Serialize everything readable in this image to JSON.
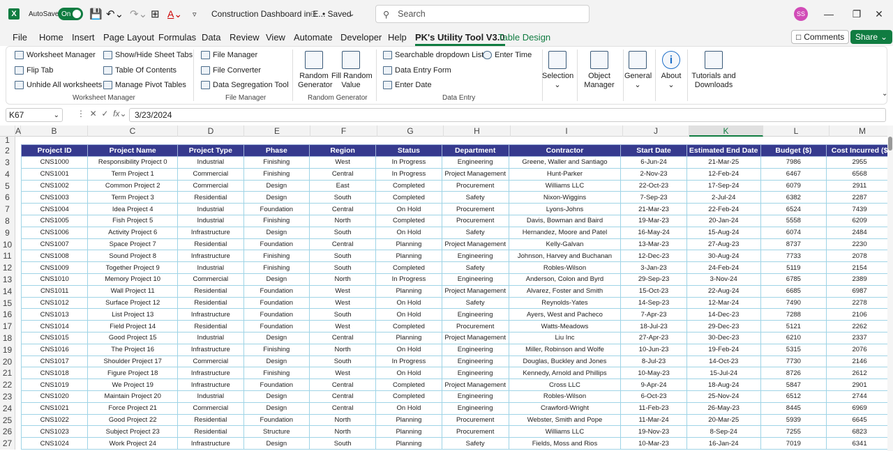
{
  "titlebar": {
    "app_icon": "X",
    "autosave_label": "AutoSave",
    "autosave_state": "On",
    "doc_title": "Construction Dashboard in E...",
    "saved_status": "• Saved",
    "search_placeholder": "Search",
    "user_initials": "SS"
  },
  "menu_tabs": [
    "File",
    "Home",
    "Insert",
    "Page Layout",
    "Formulas",
    "Data",
    "Review",
    "View",
    "Automate",
    "Developer",
    "Help",
    "PK's Utility Tool V3.0",
    "Table Design"
  ],
  "active_tab": "PK's Utility Tool V3.0",
  "comments_label": "Comments",
  "share_label": "Share",
  "ribbon": {
    "worksheet_manager": {
      "items": [
        "Worksheet Manager",
        "Flip Tab",
        "Unhide All worksheets",
        "Show/Hide Sheet Tabs",
        "Table Of Contents",
        "Manage Pivot Tables"
      ],
      "group_label": "Worksheet Manager"
    },
    "file_manager": {
      "items": [
        "File Manager",
        "File Converter",
        "Data Segregation Tool"
      ],
      "group_label": "File Manager"
    },
    "random_generator": {
      "items": [
        "Random\nGenerator",
        "Fill Random\nValue"
      ],
      "group_label": "Random Generator"
    },
    "data_entry": {
      "items": [
        "Searchable dropdown List",
        "Data Entry Form",
        "Enter Date",
        "Enter Time"
      ],
      "group_label": "Data Entry"
    },
    "big_buttons": [
      "Selection",
      "Object\nManager",
      "General",
      "About",
      "Tutorials and\nDownloads"
    ]
  },
  "formula_bar": {
    "name_box": "K67",
    "fx": "fx",
    "value": "3/23/2024"
  },
  "columns": [
    "A",
    "B",
    "C",
    "D",
    "E",
    "F",
    "G",
    "H",
    "I",
    "J",
    "K",
    "L",
    "M"
  ],
  "selected_column": "K",
  "row_numbers": [
    "1",
    "2",
    "3",
    "4",
    "5",
    "6",
    "7",
    "8",
    "9",
    "10",
    "11",
    "12",
    "13",
    "14",
    "15",
    "16",
    "17",
    "18",
    "19",
    "20",
    "21",
    "22",
    "23",
    "24",
    "25",
    "26",
    "27"
  ],
  "table": {
    "headers": [
      "Project ID",
      "Project Name",
      "Project Type",
      "Phase",
      "Region",
      "Status",
      "Department",
      "Contractor",
      "Start Date",
      "Estimated End Date",
      "Budget ($)",
      "Cost Incurred ($"
    ],
    "rows": [
      [
        "CNS1000",
        "Responsibility Project 0",
        "Industrial",
        "Finishing",
        "West",
        "In Progress",
        "Engineering",
        "Greene, Waller and Santiago",
        "6-Jun-24",
        "21-Mar-25",
        "7986",
        "2955"
      ],
      [
        "CNS1001",
        "Term Project 1",
        "Commercial",
        "Finishing",
        "Central",
        "In Progress",
        "Project Management",
        "Hunt-Parker",
        "2-Nov-23",
        "12-Feb-24",
        "6467",
        "6568"
      ],
      [
        "CNS1002",
        "Common Project 2",
        "Commercial",
        "Design",
        "East",
        "Completed",
        "Procurement",
        "Williams LLC",
        "22-Oct-23",
        "17-Sep-24",
        "6079",
        "2911"
      ],
      [
        "CNS1003",
        "Term Project 3",
        "Residential",
        "Design",
        "South",
        "Completed",
        "Safety",
        "Nixon-Wiggins",
        "7-Sep-23",
        "2-Jul-24",
        "6382",
        "2287"
      ],
      [
        "CNS1004",
        "Idea Project 4",
        "Industrial",
        "Foundation",
        "Central",
        "On Hold",
        "Procurement",
        "Lyons-Johns",
        "21-Mar-23",
        "22-Feb-24",
        "6524",
        "7439"
      ],
      [
        "CNS1005",
        "Fish Project 5",
        "Industrial",
        "Finishing",
        "North",
        "Completed",
        "Procurement",
        "Davis, Bowman and Baird",
        "19-Mar-23",
        "20-Jan-24",
        "5558",
        "6209"
      ],
      [
        "CNS1006",
        "Activity Project 6",
        "Infrastructure",
        "Design",
        "South",
        "On Hold",
        "Safety",
        "Hernandez, Moore and Patel",
        "16-May-24",
        "15-Aug-24",
        "6074",
        "2484"
      ],
      [
        "CNS1007",
        "Space Project 7",
        "Residential",
        "Foundation",
        "Central",
        "Planning",
        "Project Management",
        "Kelly-Galvan",
        "13-Mar-23",
        "27-Aug-23",
        "8737",
        "2230"
      ],
      [
        "CNS1008",
        "Sound Project 8",
        "Infrastructure",
        "Finishing",
        "South",
        "Planning",
        "Engineering",
        "Johnson, Harvey and Buchanan",
        "12-Dec-23",
        "30-Aug-24",
        "7733",
        "2078"
      ],
      [
        "CNS1009",
        "Together Project 9",
        "Industrial",
        "Finishing",
        "South",
        "Completed",
        "Safety",
        "Robles-Wilson",
        "3-Jan-23",
        "24-Feb-24",
        "5119",
        "2154"
      ],
      [
        "CNS1010",
        "Memory Project 10",
        "Commercial",
        "Design",
        "North",
        "In Progress",
        "Engineering",
        "Anderson, Colon and Byrd",
        "29-Sep-23",
        "3-Nov-24",
        "6785",
        "2389"
      ],
      [
        "CNS1011",
        "Wall Project 11",
        "Residential",
        "Foundation",
        "West",
        "Planning",
        "Project Management",
        "Alvarez, Foster and Smith",
        "15-Oct-23",
        "22-Aug-24",
        "6685",
        "6987"
      ],
      [
        "CNS1012",
        "Surface Project 12",
        "Residential",
        "Foundation",
        "West",
        "On Hold",
        "Safety",
        "Reynolds-Yates",
        "14-Sep-23",
        "12-Mar-24",
        "7490",
        "2278"
      ],
      [
        "CNS1013",
        "List Project 13",
        "Infrastructure",
        "Foundation",
        "South",
        "On Hold",
        "Engineering",
        "Ayers, West and Pacheco",
        "7-Apr-23",
        "14-Dec-23",
        "7288",
        "2106"
      ],
      [
        "CNS1014",
        "Field Project 14",
        "Residential",
        "Foundation",
        "West",
        "Completed",
        "Procurement",
        "Watts-Meadows",
        "18-Jul-23",
        "29-Dec-23",
        "5121",
        "2262"
      ],
      [
        "CNS1015",
        "Good Project 15",
        "Industrial",
        "Design",
        "Central",
        "Planning",
        "Project Management",
        "Liu Inc",
        "27-Apr-23",
        "30-Dec-23",
        "6210",
        "2337"
      ],
      [
        "CNS1016",
        "The Project 16",
        "Infrastructure",
        "Finishing",
        "North",
        "On Hold",
        "Engineering",
        "Miller, Robinson and Wolfe",
        "10-Jun-23",
        "19-Feb-24",
        "5315",
        "2076"
      ],
      [
        "CNS1017",
        "Shoulder Project 17",
        "Commercial",
        "Design",
        "South",
        "In Progress",
        "Engineering",
        "Douglas, Buckley and Jones",
        "8-Jul-23",
        "14-Oct-23",
        "7730",
        "2146"
      ],
      [
        "CNS1018",
        "Figure Project 18",
        "Infrastructure",
        "Finishing",
        "West",
        "On Hold",
        "Engineering",
        "Kennedy, Arnold and Phillips",
        "10-May-23",
        "15-Jul-24",
        "8726",
        "2612"
      ],
      [
        "CNS1019",
        "We Project 19",
        "Infrastructure",
        "Foundation",
        "Central",
        "Completed",
        "Project Management",
        "Cross LLC",
        "9-Apr-24",
        "18-Aug-24",
        "5847",
        "2901"
      ],
      [
        "CNS1020",
        "Maintain Project 20",
        "Industrial",
        "Design",
        "Central",
        "Completed",
        "Engineering",
        "Robles-Wilson",
        "6-Oct-23",
        "25-Nov-24",
        "6512",
        "2744"
      ],
      [
        "CNS1021",
        "Force Project 21",
        "Commercial",
        "Design",
        "Central",
        "On Hold",
        "Engineering",
        "Crawford-Wright",
        "11-Feb-23",
        "26-May-23",
        "8445",
        "6969"
      ],
      [
        "CNS1022",
        "Good Project 22",
        "Residential",
        "Foundation",
        "North",
        "Planning",
        "Procurement",
        "Webster, Smith and Pope",
        "11-Mar-24",
        "20-Mar-25",
        "5939",
        "6645"
      ],
      [
        "CNS1023",
        "Subject Project 23",
        "Residential",
        "Structure",
        "North",
        "Planning",
        "Procurement",
        "Williams LLC",
        "19-Nov-23",
        "8-Sep-24",
        "7255",
        "6823"
      ],
      [
        "CNS1024",
        "Work Project 24",
        "Infrastructure",
        "Design",
        "South",
        "Planning",
        "Safety",
        "Fields, Moss and Rios",
        "10-Mar-23",
        "16-Jan-24",
        "7019",
        "6341"
      ]
    ]
  },
  "colors": {
    "header_bg": "#363a8e",
    "accent": "#107c41",
    "cell_border": "#9fd4e6"
  }
}
